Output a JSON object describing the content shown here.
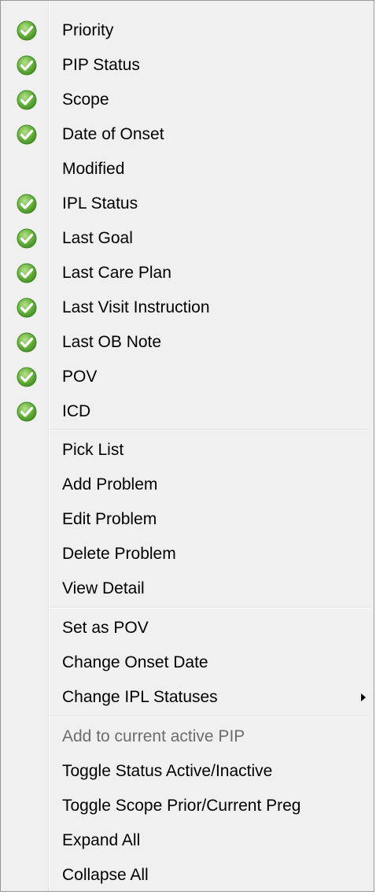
{
  "menu": {
    "columns": [
      {
        "label": "Priority",
        "checked": true
      },
      {
        "label": "PIP Status",
        "checked": true
      },
      {
        "label": "Scope",
        "checked": true
      },
      {
        "label": "Date of Onset",
        "checked": true
      },
      {
        "label": "Modified",
        "checked": false
      },
      {
        "label": "IPL Status",
        "checked": true
      },
      {
        "label": "Last Goal",
        "checked": true
      },
      {
        "label": "Last Care Plan",
        "checked": true
      },
      {
        "label": "Last Visit Instruction",
        "checked": true
      },
      {
        "label": "Last OB Note",
        "checked": true
      },
      {
        "label": "POV",
        "checked": true
      },
      {
        "label": "ICD",
        "checked": true
      }
    ],
    "problem_actions": [
      {
        "label": "Pick List"
      },
      {
        "label": "Add Problem"
      },
      {
        "label": "Edit Problem"
      },
      {
        "label": "Delete Problem"
      },
      {
        "label": "View Detail"
      }
    ],
    "status_actions": [
      {
        "label": "Set as POV"
      },
      {
        "label": "Change Onset Date"
      },
      {
        "label": "Change IPL Statuses",
        "submenu": true
      }
    ],
    "other_actions": [
      {
        "label": "Add to current active PIP",
        "disabled": true
      },
      {
        "label": "Toggle Status Active/Inactive"
      },
      {
        "label": "Toggle Scope Prior/Current Preg"
      },
      {
        "label": "Expand All"
      },
      {
        "label": "Collapse All"
      }
    ]
  },
  "icons": {
    "check": "check-circle-icon",
    "submenu": "submenu-arrow-icon"
  },
  "colors": {
    "check_fill": "#6ab43e",
    "check_dark": "#3f8a22",
    "disabled_text": "#6d6d6d"
  }
}
